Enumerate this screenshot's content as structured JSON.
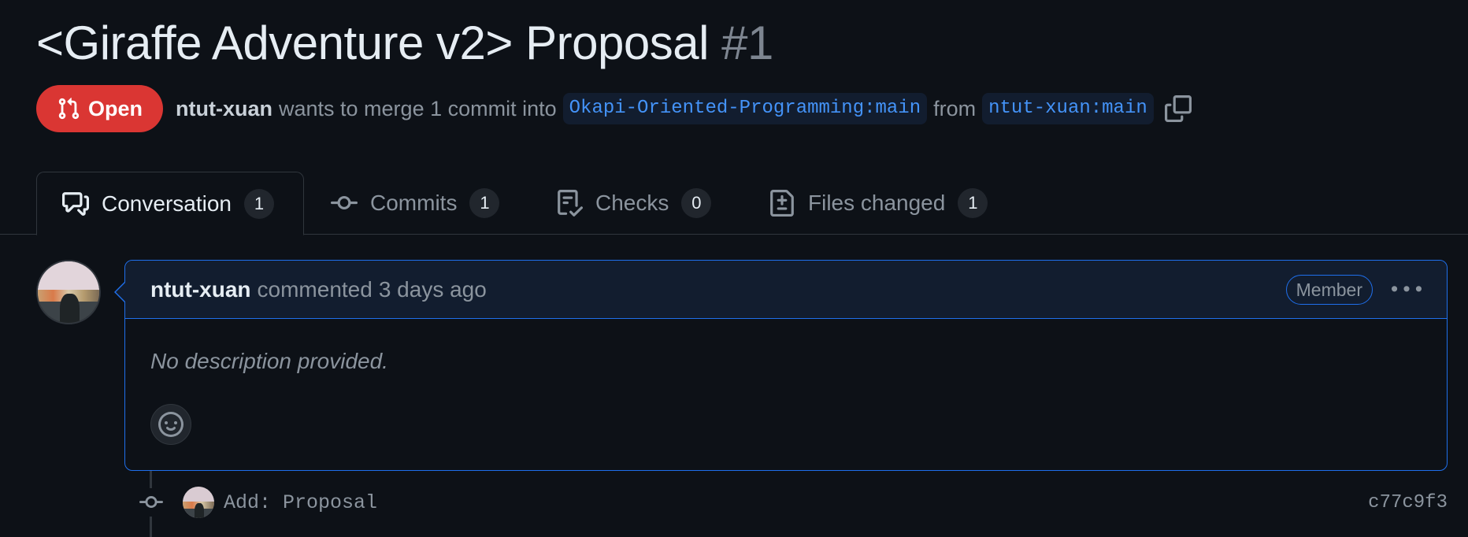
{
  "pr": {
    "title": "<Giraffe Adventure v2> Proposal",
    "number": "#1",
    "state": "Open",
    "author": "ntut-xuan",
    "merge_text_1": "wants to merge 1 commit into",
    "base_branch": "Okapi-Oriented-Programming:main",
    "merge_text_2": "from",
    "head_branch": "ntut-xuan:main"
  },
  "tabs": [
    {
      "label": "Conversation",
      "count": "1",
      "icon": "comment-discussion-icon",
      "active": true
    },
    {
      "label": "Commits",
      "count": "1",
      "icon": "git-commit-icon"
    },
    {
      "label": "Checks",
      "count": "0",
      "icon": "checklist-icon"
    },
    {
      "label": "Files changed",
      "count": "1",
      "icon": "file-diff-icon"
    }
  ],
  "comment": {
    "author": "ntut-xuan",
    "action": "commented",
    "time": "3 days ago",
    "role": "Member",
    "body": "No description provided."
  },
  "commit": {
    "message": "Add: Proposal",
    "sha": "c77c9f3"
  },
  "colors": {
    "background": "#0d1117",
    "open_badge": "#da3633",
    "link_blue": "#4493f8",
    "accent_border": "#1f6feb"
  }
}
